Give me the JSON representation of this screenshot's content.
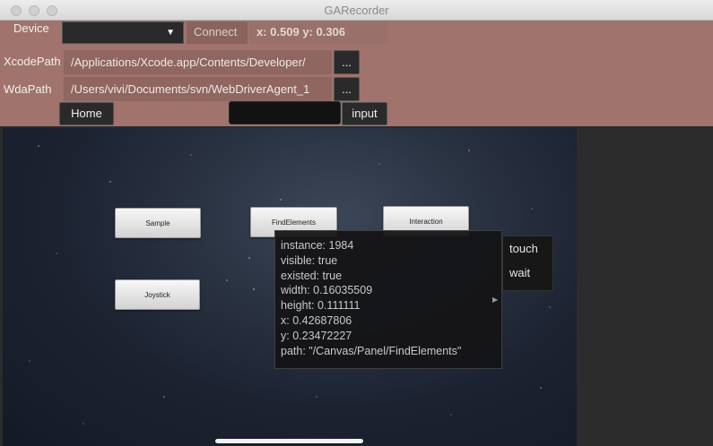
{
  "window": {
    "title": "GARecorder"
  },
  "toolbar": {
    "device_label": "Device",
    "device_selected": "",
    "connect_label": "Connect",
    "coords": "x: 0.509 y: 0.306",
    "xcode_label": "XcodePath",
    "xcode_value": "/Applications/Xcode.app/Contents/Developer/",
    "wda_label": "WdaPath",
    "wda_value": "/Users/vivi/Documents/svn/WebDriverAgent_1",
    "browse_label": "...",
    "home_label": "Home",
    "input_value": "",
    "input_label": "input"
  },
  "game": {
    "buttons": [
      "Sample",
      "FindElements",
      "Interaction",
      "Joystick"
    ]
  },
  "tooltip": {
    "lines": [
      "instance: 1984",
      "visible: true",
      "existed: true",
      "width: 0.16035509",
      "height: 0.111111",
      "x: 0.42687806",
      "y: 0.23472227",
      "path: \"/Canvas/Panel/FindElements\""
    ]
  },
  "context_menu": {
    "items": [
      "touch",
      "wait"
    ]
  }
}
